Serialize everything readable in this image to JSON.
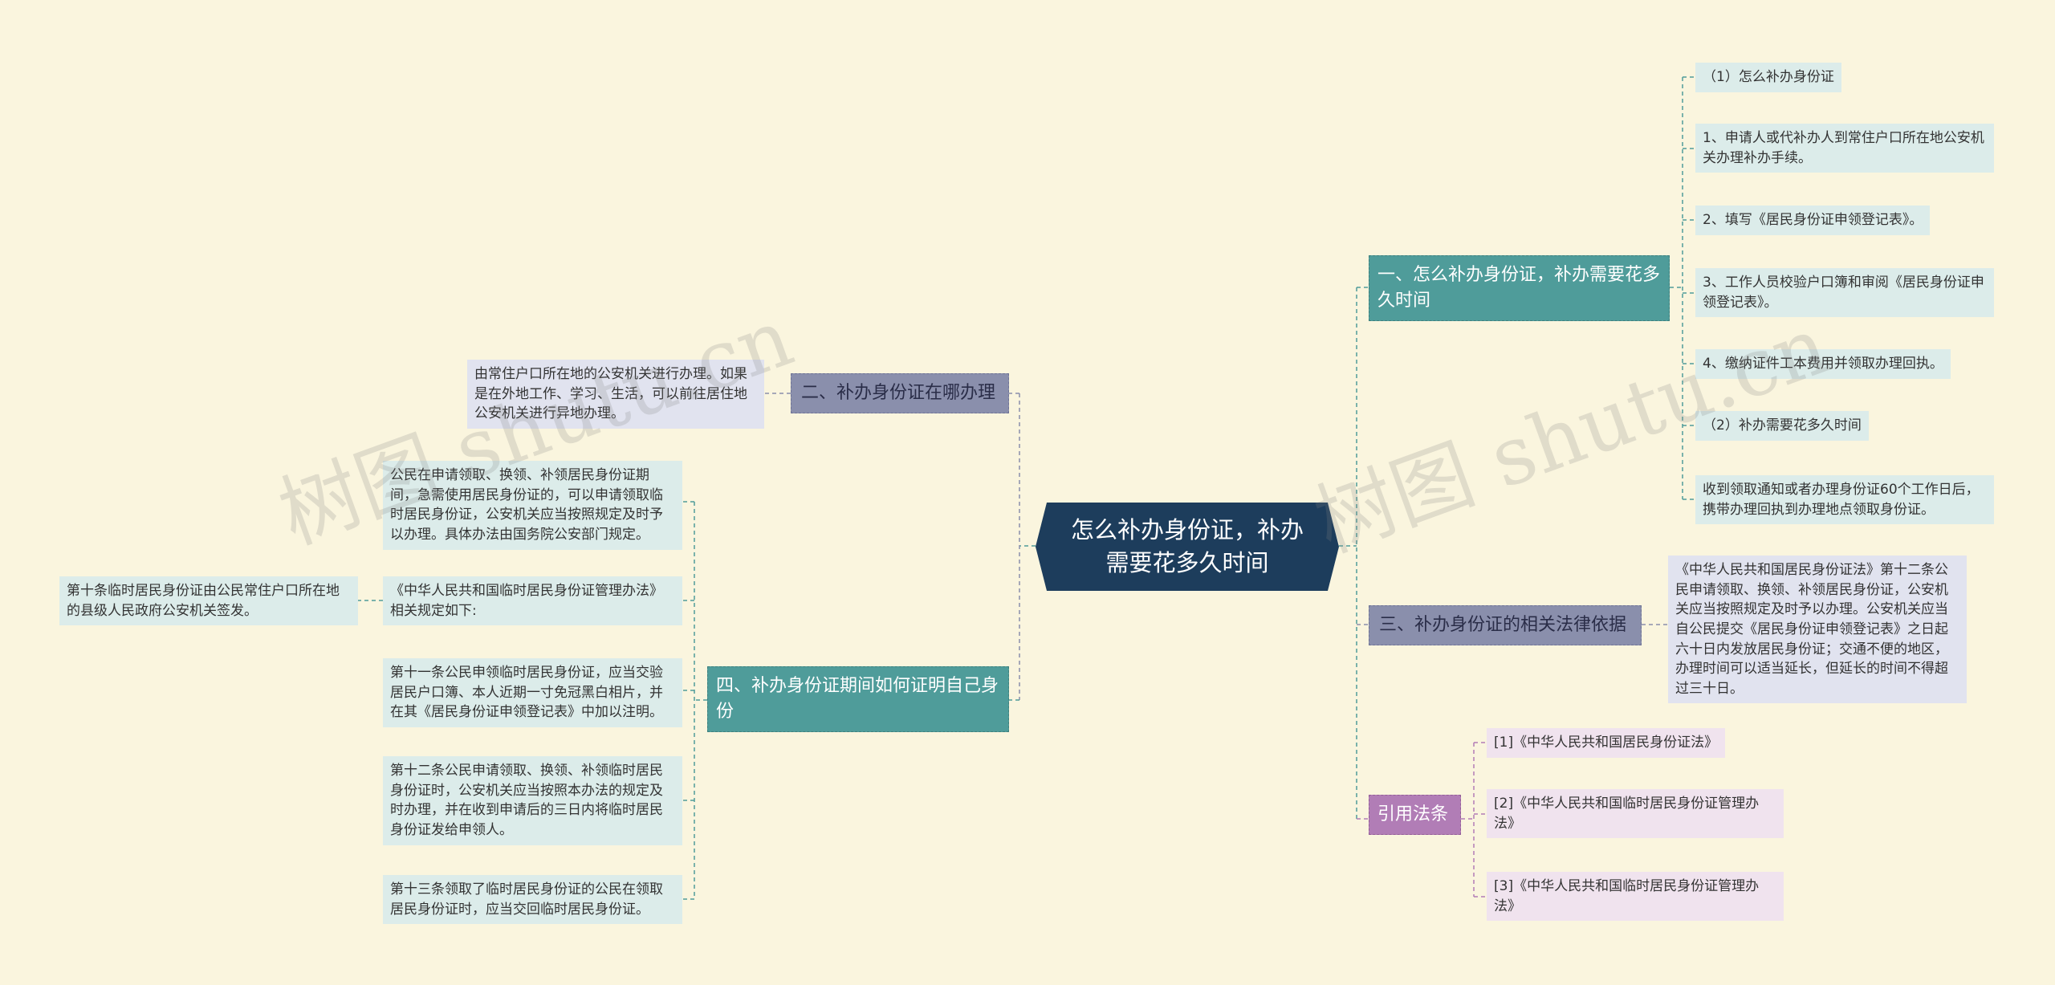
{
  "watermark": "树图 shutu.cn",
  "root": {
    "label": "怎么补办身份证，补办需要花多久时间"
  },
  "branches": {
    "b1": {
      "label": "一、怎么补办身份证，补办需要花多久时间",
      "leaves": [
        "（1）怎么补办身份证",
        "1、申请人或代补办人到常住户口所在地公安机关办理补办手续。",
        "2、填写《居民身份证申领登记表》。",
        "3、工作人员校验户口簿和审阅《居民身份证申领登记表》。",
        "4、缴纳证件工本费用并领取办理回执。",
        "（2）补办需要花多久时间",
        "收到领取通知或者办理身份证60个工作日后，携带办理回执到办理地点领取身份证。"
      ]
    },
    "b2": {
      "label": "二、补办身份证在哪办理",
      "leaves": [
        "由常住户口所在地的公安机关进行办理。如果是在外地工作、学习、生活，可以前往居住地公安机关进行异地办理。"
      ]
    },
    "b3": {
      "label": "三、补办身份证的相关法律依据",
      "leaves": [
        "《中华人民共和国居民身份证法》第十二条公民申请领取、换领、补领居民身份证，公安机关应当按照规定及时予以办理。公安机关应当自公民提交《居民身份证申领登记表》之日起六十日内发放居民身份证；交通不便的地区，办理时间可以适当延长，但延长的时间不得超过三十日。"
      ]
    },
    "b4": {
      "label": "四、补办身份证期间如何证明自己身份",
      "leaves": [
        "公民在申请领取、换领、补领居民身份证期间，急需使用居民身份证的，可以申请领取临时居民身份证，公安机关应当按照规定及时予以办理。具体办法由国务院公安部门规定。",
        "《中华人民共和国临时居民身份证管理办法》相关规定如下:",
        "第十一条公民申领临时居民身份证，应当交验居民户口簿、本人近期一寸免冠黑白相片，并在其《居民身份证申领登记表》中加以注明。",
        "第十二条公民申请领取、换领、补领临时居民身份证时，公安机关应当按照本办法的规定及时办理，并在收到申请后的三日内将临时居民身份证发给申领人。",
        "第十三条领取了临时居民身份证的公民在领取居民身份证时，应当交回临时居民身份证。"
      ],
      "subleaf": "第十条临时居民身份证由公民常住户口所在地的县级人民政府公安机关签发。"
    },
    "b5": {
      "label": "引用法条",
      "leaves": [
        "[1]《中华人民共和国居民身份证法》",
        "[2]《中华人民共和国临时居民身份证管理办法》",
        "[3]《中华人民共和国临时居民身份证管理办法》"
      ]
    }
  },
  "colors": {
    "background": "#faf5de",
    "root": "#1d3d5c",
    "teal": "#4f9c9a",
    "slate": "#8a8fac",
    "purple": "#b17db6"
  }
}
